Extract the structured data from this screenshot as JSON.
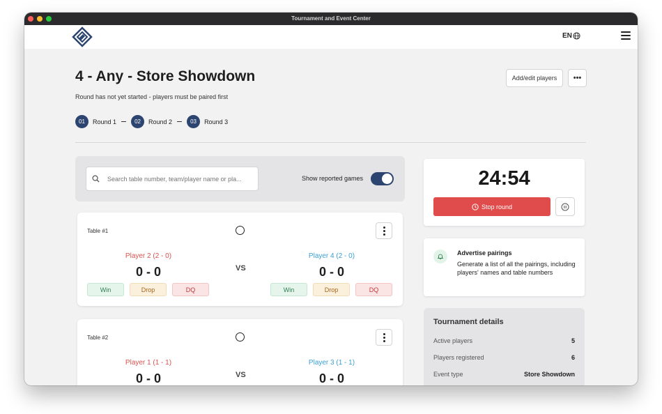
{
  "window": {
    "title": "Tournament and Event Center"
  },
  "header": {
    "language": "EN"
  },
  "event": {
    "title": "4 - Any - Store Showdown",
    "status": "Round has not yet started - players must be paired first",
    "add_players_label": "Add/edit players",
    "more_label": "•••"
  },
  "rounds": [
    {
      "num": "01",
      "label": "Round 1"
    },
    {
      "num": "02",
      "label": "Round 2"
    },
    {
      "num": "03",
      "label": "Round 3"
    }
  ],
  "search": {
    "placeholder": "Search table number, team/player name or pla...",
    "toggle_label": "Show reported games",
    "toggle_on": true
  },
  "matches": [
    {
      "table": "Table #1",
      "left_player": "Player 2 (2 - 0)",
      "left_score": "0 - 0",
      "right_player": "Player 4 (2 - 0)",
      "right_score": "0 - 0",
      "vs": "VS",
      "buttons": {
        "win": "Win",
        "drop": "Drop",
        "dq": "DQ"
      }
    },
    {
      "table": "Table #2",
      "left_player": "Player 1 (1 - 1)",
      "left_score": "0 - 0",
      "right_player": "Player 3 (1 - 1)",
      "right_score": "0 - 0",
      "vs": "VS"
    }
  ],
  "timer": {
    "time": "24:54",
    "stop_label": "Stop round"
  },
  "advertise": {
    "title": "Advertise pairings",
    "description": "Generate a list of all the pairings, including players' names and table numbers"
  },
  "details": {
    "title": "Tournament details",
    "rows": [
      {
        "label": "Active players",
        "value": "5"
      },
      {
        "label": "Players registered",
        "value": "6"
      },
      {
        "label": "Event type",
        "value": "Store Showdown"
      }
    ]
  },
  "colors": {
    "accent": "#2c4470",
    "player_left": "#d6534f",
    "player_right": "#3aa0d4",
    "stop": "#e04c4c"
  }
}
